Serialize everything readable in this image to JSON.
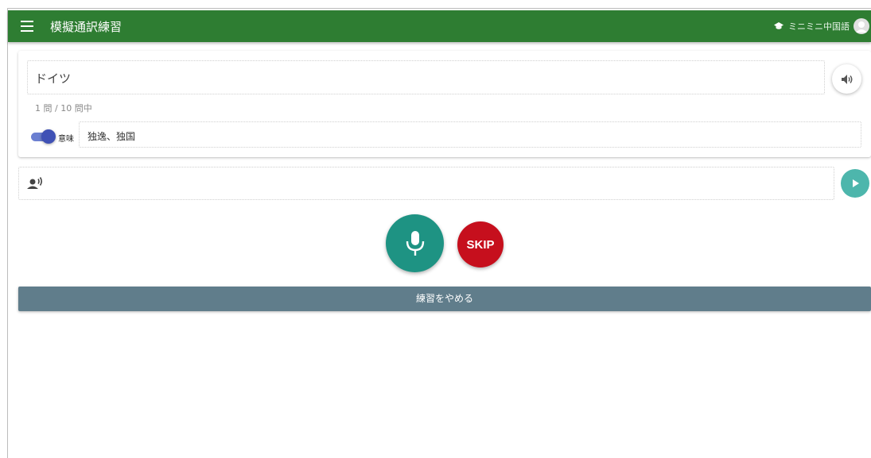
{
  "appbar": {
    "title": "模擬通訳練習",
    "user_name": "ミニミニ中国語",
    "bg_color": "#2e7d32"
  },
  "question": {
    "word": "ドイツ",
    "counter": "1 問 / 10 問中",
    "meaning_toggle_on": true,
    "meaning_label": "意味",
    "meaning_value": "独逸、独国"
  },
  "answer": {
    "value": "",
    "voice_icon": "record-voice-icon",
    "play_icon": "play-icon"
  },
  "controls": {
    "mic_icon": "microphone-icon",
    "mic_color": "#1e9383",
    "skip_label": "SKIP",
    "skip_color": "#c60f1d",
    "quit_label": "練習をやめる",
    "quit_color": "#607d8b"
  }
}
